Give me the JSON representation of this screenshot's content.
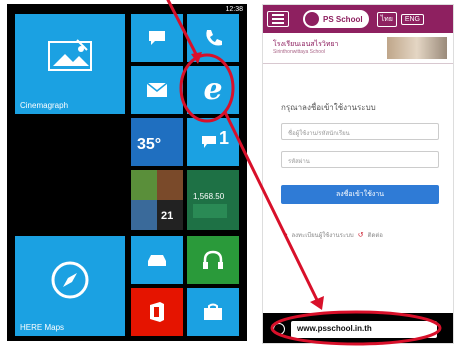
{
  "left_phone": {
    "clock": "12:38",
    "tiles": {
      "cinemagraph_label": "Cinemagraph",
      "weather_temp": "35°",
      "messages_count": "1",
      "finance_value": "1,568.50",
      "people_count": "21",
      "here_maps_label": "HERE Maps"
    },
    "colors": {
      "tile_blue": "#1ba1e2",
      "tile_red": "#e51400",
      "tile_green": "#1e7145"
    }
  },
  "right_phone": {
    "app_name": "PS School",
    "lang_thai": "ไทย",
    "lang_eng": "ENG",
    "school_name": "โรงเรียนเอนสไรวิทยา",
    "school_subtitle": "Sirinthonwittaya School",
    "login_title": "กรุณาลงชื่อเข้าใช้งานระบบ",
    "username_placeholder": "ชื่อผู้ใช้งาน/รหัสนักเรียน",
    "password_placeholder": "รหัสผ่าน",
    "login_button": "ลงชื่อเข้าใช้งาน",
    "help_text": "ลงทะเบียนผู้ใช้งานระบบ",
    "help_link": "ติดต่อ",
    "address": "www.psschool.in.th",
    "colors": {
      "brand": "#8e2060",
      "button": "#2f7bd6"
    }
  },
  "annotations": {
    "color": "#d8102a"
  }
}
